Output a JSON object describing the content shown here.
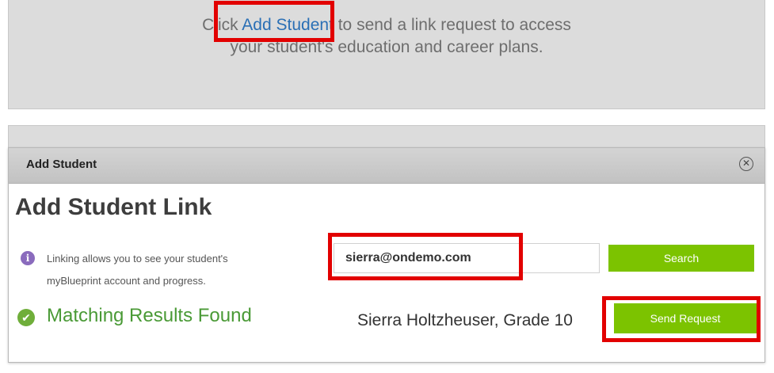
{
  "top_panel": {
    "text_before_link": "Click ",
    "link_label": "Add Student",
    "text_after_link": " to send a link request to access",
    "text_line2": "your student's education and career plans."
  },
  "modal": {
    "header_title": "Add Student",
    "close_icon": "close-circle-icon",
    "heading": "Add Student Link",
    "info_icon": "info-icon",
    "info_text_line1": "Linking allows you to see your student's",
    "info_text_line2": "myBlueprint account and progress.",
    "email_value": "sierra@ondemo.com",
    "search_label": "Search",
    "check_icon": "check-circle-icon",
    "match_text": "Matching Results Found",
    "result_name": "Sierra Holtzheuser, Grade 10",
    "send_label": "Send Request"
  },
  "colors": {
    "highlight": "#e20000",
    "accent_green": "#7cc300",
    "link_blue": "#2a6fb5",
    "success_green": "#4a9a36",
    "info_purple": "#8a6bbd"
  }
}
